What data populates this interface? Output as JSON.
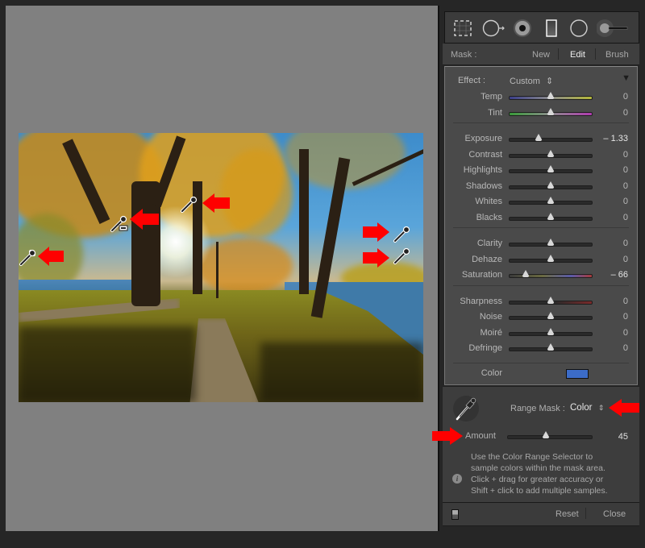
{
  "canvas": {
    "photo_description": "Autumn park path with yellow-leaved trees, blue sky and lake",
    "sampler_markers": [
      {
        "id": "sample-1",
        "type": "eyedropper"
      },
      {
        "id": "sample-2",
        "type": "eyedropper-add"
      },
      {
        "id": "sample-3",
        "type": "eyedropper"
      },
      {
        "id": "sample-4",
        "type": "eyedropper"
      },
      {
        "id": "sample-5",
        "type": "eyedropper"
      }
    ],
    "annotation_color": "#ff0000"
  },
  "toolbar": {
    "tools": [
      {
        "name": "crop-overlay-icon"
      },
      {
        "name": "spot-removal-icon"
      },
      {
        "name": "red-eye-icon"
      },
      {
        "name": "graduated-filter-icon"
      },
      {
        "name": "radial-filter-icon"
      },
      {
        "name": "adjustment-brush-icon"
      }
    ]
  },
  "mask": {
    "label": "Mask :",
    "new": "New",
    "edit": "Edit",
    "brush": "Brush"
  },
  "effect": {
    "label": "Effect :",
    "preset": "Custom",
    "preset_arrows": "⇕",
    "collapse": "▼",
    "groups": [
      [
        {
          "label": "Temp",
          "value": "0",
          "position": 0.5,
          "track": "temp"
        },
        {
          "label": "Tint",
          "value": "0",
          "position": 0.5,
          "track": "tint"
        }
      ],
      [
        {
          "label": "Exposure",
          "value": "– 1.33",
          "position": 0.35,
          "track": "plain",
          "emph": true
        },
        {
          "label": "Contrast",
          "value": "0",
          "position": 0.5,
          "track": "plain"
        },
        {
          "label": "Highlights",
          "value": "0",
          "position": 0.5,
          "track": "plain"
        },
        {
          "label": "Shadows",
          "value": "0",
          "position": 0.5,
          "track": "plain"
        },
        {
          "label": "Whites",
          "value": "0",
          "position": 0.5,
          "track": "plain"
        },
        {
          "label": "Blacks",
          "value": "0",
          "position": 0.5,
          "track": "plain"
        }
      ],
      [
        {
          "label": "Clarity",
          "value": "0",
          "position": 0.5,
          "track": "plain"
        },
        {
          "label": "Dehaze",
          "value": "0",
          "position": 0.5,
          "track": "plain"
        },
        {
          "label": "Saturation",
          "value": "– 66",
          "position": 0.2,
          "track": "saturation",
          "emph": true
        }
      ],
      [
        {
          "label": "Sharpness",
          "value": "0",
          "position": 0.5,
          "track": "sharpness"
        },
        {
          "label": "Noise",
          "value": "0",
          "position": 0.5,
          "track": "plain"
        },
        {
          "label": "Moiré",
          "value": "0",
          "position": 0.5,
          "track": "plain"
        },
        {
          "label": "Defringe",
          "value": "0",
          "position": 0.5,
          "track": "plain"
        }
      ]
    ],
    "color_label": "Color",
    "color_swatch": "#3c6cc8"
  },
  "range_mask": {
    "label": "Range Mask :",
    "value": "Color",
    "arrows": "⇕",
    "amount_label": "Amount",
    "amount_value": "45",
    "amount_position": 0.45,
    "info": "Use the Color Range Selector to sample colors within the mask area. Click + drag for greater accuracy or Shift + click to add multiple samples.",
    "info_lines": [
      "Use the Color Range Selector to",
      "sample colors within the mask area.",
      "Click + drag for greater accuracy or",
      "Shift + click to add multiple samples."
    ]
  },
  "footer": {
    "reset": "Reset",
    "close": "Close"
  }
}
